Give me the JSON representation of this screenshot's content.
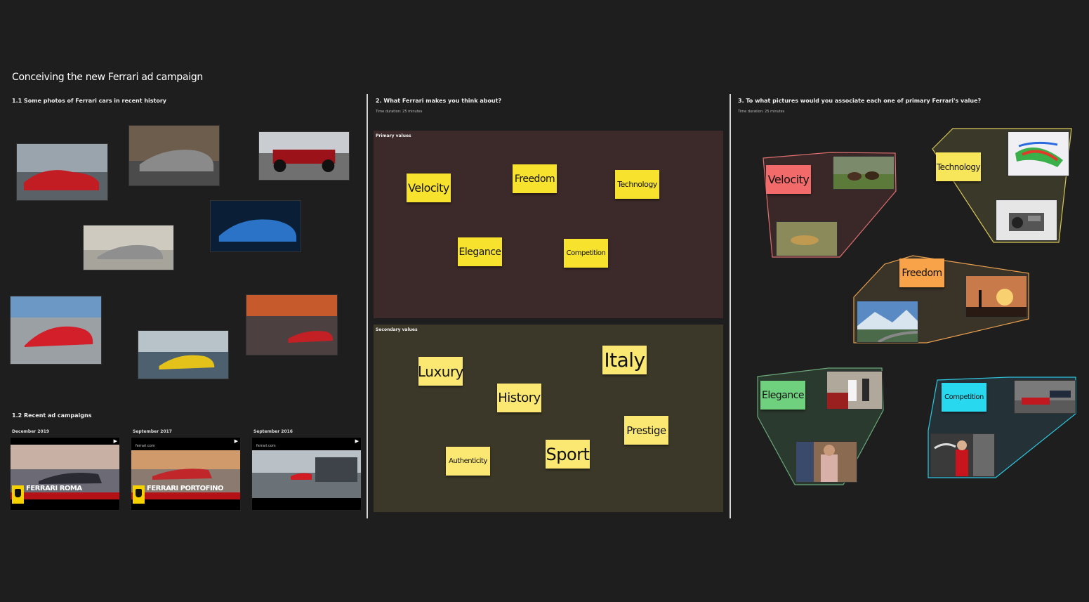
{
  "board": {
    "title": "Conceiving the new Ferrari ad campaign"
  },
  "section1": {
    "heading": "1.1 Some photos of Ferrari cars in recent history",
    "photos": [
      {
        "name": "red-portofino-coast-photo",
        "colors": [
          "#9aa4ad",
          "#5a6268",
          "#c21d22"
        ]
      },
      {
        "name": "grey-812-superfast-photo",
        "colors": [
          "#6d5d4c",
          "#4b4b4b",
          "#8a8a8a"
        ]
      },
      {
        "name": "f1-race-car-photo",
        "colors": [
          "#c9ccd0",
          "#707070",
          "#9b1218"
        ]
      },
      {
        "name": "blue-sf90-photo",
        "colors": [
          "#0a1e35",
          "#2b73c6",
          "#0b3f8b"
        ]
      },
      {
        "name": "silver-roma-photo",
        "colors": [
          "#cfcabf",
          "#a7a49c",
          "#8f8f8f"
        ]
      },
      {
        "name": "red-f8-track-photo",
        "colors": [
          "#6b98c4",
          "#9aa0a4",
          "#d21f2a"
        ]
      },
      {
        "name": "yellow-spider-photo",
        "colors": [
          "#b7c2c9",
          "#4d6070",
          "#e5c21a"
        ]
      },
      {
        "name": "red-car-castle-sunset-photo",
        "colors": [
          "#c65a2d",
          "#4c4040",
          "#c22025"
        ]
      }
    ]
  },
  "section1b": {
    "heading": "1.2 Recent ad campaigns",
    "videos": [
      {
        "date": "December 2019",
        "label": "FERRARI ROMA",
        "url": "",
        "colors": [
          "#c8b1a4",
          "#6b6a75",
          "#2a2a33"
        ],
        "shield": true
      },
      {
        "date": "September 2017",
        "label": "FERRARI PORTOFINO",
        "url": "ferrari.com",
        "colors": [
          "#d09a6a",
          "#8a7a70",
          "#3b3b3b"
        ],
        "shield": true
      },
      {
        "date": "September 2016",
        "label": "",
        "url": "ferrari.com",
        "colors": [
          "#b9c0c6",
          "#6a7278",
          "#3d4348"
        ],
        "shield": false
      }
    ]
  },
  "section2": {
    "heading": "2. What Ferrari makes you think about?",
    "duration": "Time duration: 25 minutes",
    "primary": {
      "label": "Primary values",
      "bg": "#3c2a2a",
      "notes": [
        "Velocity",
        "Freedom",
        "Technology",
        "Elegance",
        "Competition"
      ]
    },
    "secondary": {
      "label": "Secondary values",
      "bg": "#3c3829",
      "notes": [
        "Luxury",
        "Italy",
        "History",
        "Prestige",
        "Authenticity",
        "Sport"
      ]
    }
  },
  "section3": {
    "heading": "3. To what pictures would you associate each one of primary Ferrari's value?",
    "duration": "Time duration: 25 minutes",
    "groups": [
      {
        "label": "Velocity",
        "note_color": "#f26a6a",
        "border": "#e07070",
        "fill": "#3a2828",
        "images": [
          "horse-race-photo",
          "cheetah-running-photo"
        ]
      },
      {
        "label": "Technology",
        "note_color": "#f7e55a",
        "border": "#d8c85a",
        "fill": "#3a3828",
        "images": [
          "aerodynamics-simulation-photo",
          "engine-photo"
        ]
      },
      {
        "label": "Freedom",
        "note_color": "#f8a24a",
        "border": "#e8a050",
        "fill": "#3a3328",
        "images": [
          "person-sunset-photo",
          "mountain-road-photo"
        ]
      },
      {
        "label": "Elegance",
        "note_color": "#6fd07e",
        "border": "#6aa87a",
        "fill": "#2b3a2e",
        "images": [
          "wedding-car-photo",
          "suited-man-photo"
        ]
      },
      {
        "label": "Competition",
        "note_color": "#27d8ee",
        "border": "#2ec8e0",
        "fill": "#243238",
        "images": [
          "f1-cars-racing-photo",
          "champagne-celebration-photo"
        ]
      }
    ]
  }
}
